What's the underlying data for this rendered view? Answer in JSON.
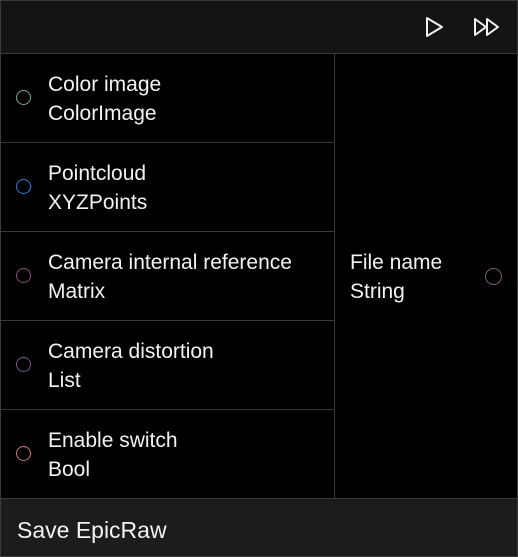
{
  "node": {
    "title": "Save EpicRaw",
    "toolbar": {
      "run_icon": "play-icon",
      "fast_forward_icon": "fast-forward-icon"
    },
    "inputs": [
      {
        "name": "Color image",
        "type": "ColorImage",
        "color": "#7fa88a"
      },
      {
        "name": "Pointcloud",
        "type": "XYZPoints",
        "color": "#2f7fcf"
      },
      {
        "name": "Camera internal reference",
        "type": "Matrix",
        "color": "#8a4f7a"
      },
      {
        "name": "Camera distortion",
        "type": "List",
        "color": "#7a5a8a"
      },
      {
        "name": "Enable switch",
        "type": "Bool",
        "color": "#c9787a"
      }
    ],
    "output": {
      "name": "File name",
      "type": "String",
      "color": "#8a4f8a"
    }
  }
}
